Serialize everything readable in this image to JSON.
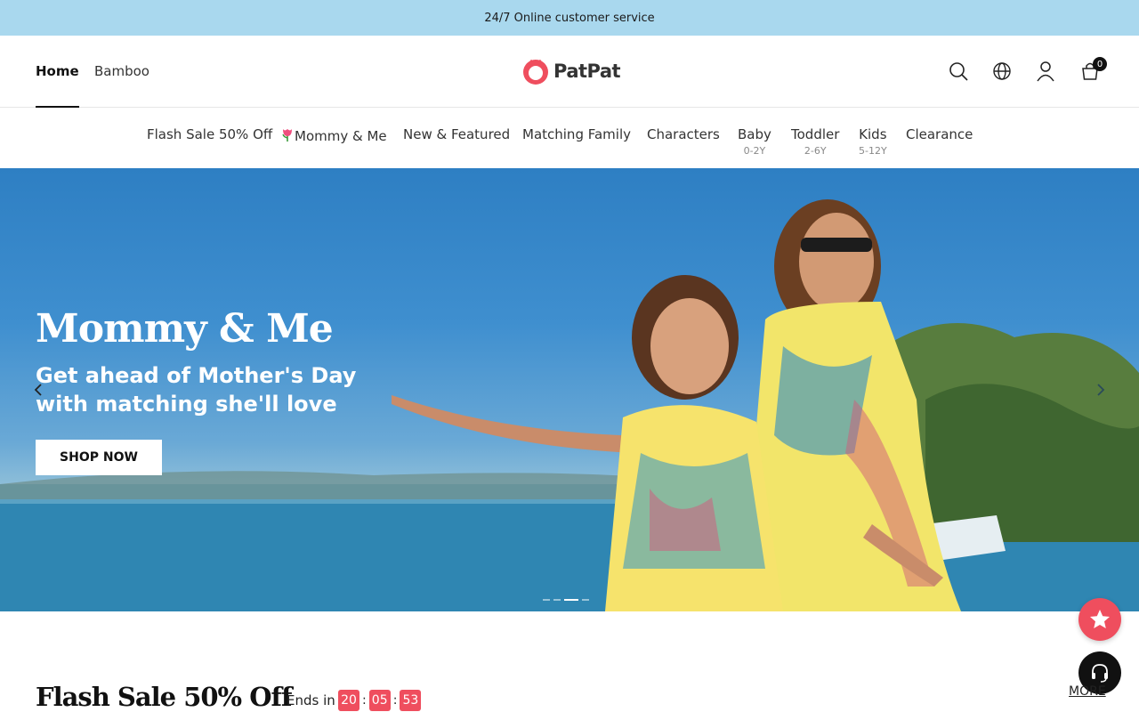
{
  "announcement": {
    "text": "24/7 Online customer service"
  },
  "header": {
    "tabs": [
      {
        "label": "Home",
        "active": true
      },
      {
        "label": "Bamboo",
        "active": false
      }
    ],
    "logo_text": "PatPat",
    "icons": [
      "search-icon",
      "globe-icon",
      "account-icon",
      "cart-icon"
    ],
    "cart_count": "0"
  },
  "categories": [
    {
      "label": "Flash Sale 50% Off",
      "sub": ""
    },
    {
      "label": "Mommy & Me",
      "sub": "",
      "icon": "tulip-icon"
    },
    {
      "label": "New & Featured",
      "sub": ""
    },
    {
      "label": "Matching Family",
      "sub": ""
    },
    {
      "label": "Characters",
      "sub": ""
    },
    {
      "label": "Baby",
      "sub": "0-2Y"
    },
    {
      "label": "Toddler",
      "sub": "2-6Y"
    },
    {
      "label": "Kids",
      "sub": "5-12Y"
    },
    {
      "label": "Clearance",
      "sub": ""
    }
  ],
  "hero": {
    "title": "Mommy & Me",
    "subtitle": "Get ahead of Mother's Day with matching she'll love",
    "cta": "SHOP NOW",
    "slide_count": 4,
    "active_slide": 3
  },
  "flash_sale": {
    "title": "Flash Sale 50% Off",
    "ends_label": "Ends in",
    "hours": "20",
    "minutes": "05",
    "seconds": "53",
    "more_label": "MORE"
  },
  "colors": {
    "announcement_bg": "#a9d8ee",
    "brand_red": "#ef4e5e",
    "text_dark": "#111111"
  }
}
